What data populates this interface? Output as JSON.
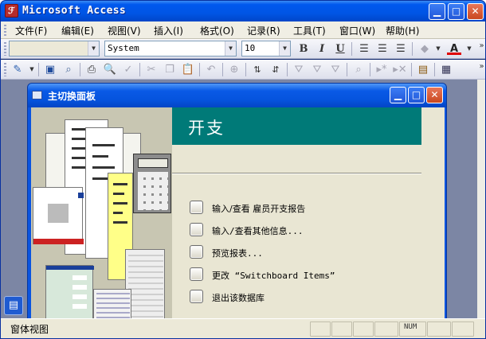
{
  "window": {
    "title": "Microsoft Access",
    "app_icon": "access-key-icon"
  },
  "menu": [
    {
      "label": "文件(F)"
    },
    {
      "label": "编辑(E)"
    },
    {
      "label": "视图(V)"
    },
    {
      "label": "插入(I)"
    },
    {
      "label": "格式(O)"
    },
    {
      "label": "记录(R)"
    },
    {
      "label": "工具(T)"
    },
    {
      "label": "窗口(W)"
    },
    {
      "label": "帮助(H)"
    }
  ],
  "formatting_toolbar": {
    "object_value": "",
    "font_value": "System",
    "size_value": "10",
    "bold": "B",
    "italic": "I",
    "underline": "U"
  },
  "switchboard": {
    "window_title": "主切换面板",
    "header": "开支",
    "header_color": "#007a78",
    "items": [
      {
        "label": "输入/查看 雇员开支报告"
      },
      {
        "label": "输入/查看其他信息..."
      },
      {
        "label": "预览报表..."
      },
      {
        "label": "更改 “Switchboard Items”"
      },
      {
        "label": "退出该数据库"
      }
    ]
  },
  "status": {
    "mode": "窗体视图",
    "num": "NUM"
  }
}
